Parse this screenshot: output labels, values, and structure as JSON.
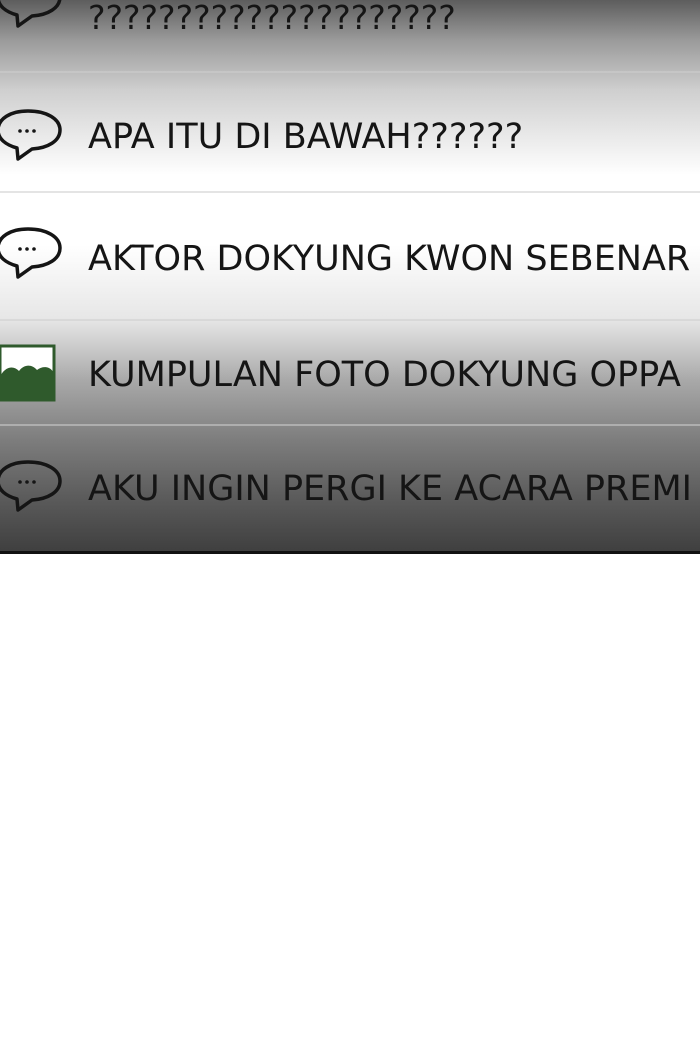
{
  "chat_list": {
    "items": [
      {
        "icon": "speech-bubble-icon",
        "title": "?????????????????????"
      },
      {
        "icon": "speech-bubble-icon",
        "title": "APA ITU DI BAWAH??????"
      },
      {
        "icon": "speech-bubble-icon",
        "title": "AKTOR DOKYUNG KWON SEBENAR"
      },
      {
        "icon": "image-icon",
        "title": "KUMPULAN FOTO DOKYUNG OPPA"
      },
      {
        "icon": "speech-bubble-icon",
        "title": "AKU INGIN PERGI KE ACARA PREMI"
      }
    ]
  },
  "colors": {
    "text": "#151515",
    "image_icon_green": "#2f5a2c",
    "divider": "#cdcdcd",
    "bottom_border": "#111111"
  }
}
